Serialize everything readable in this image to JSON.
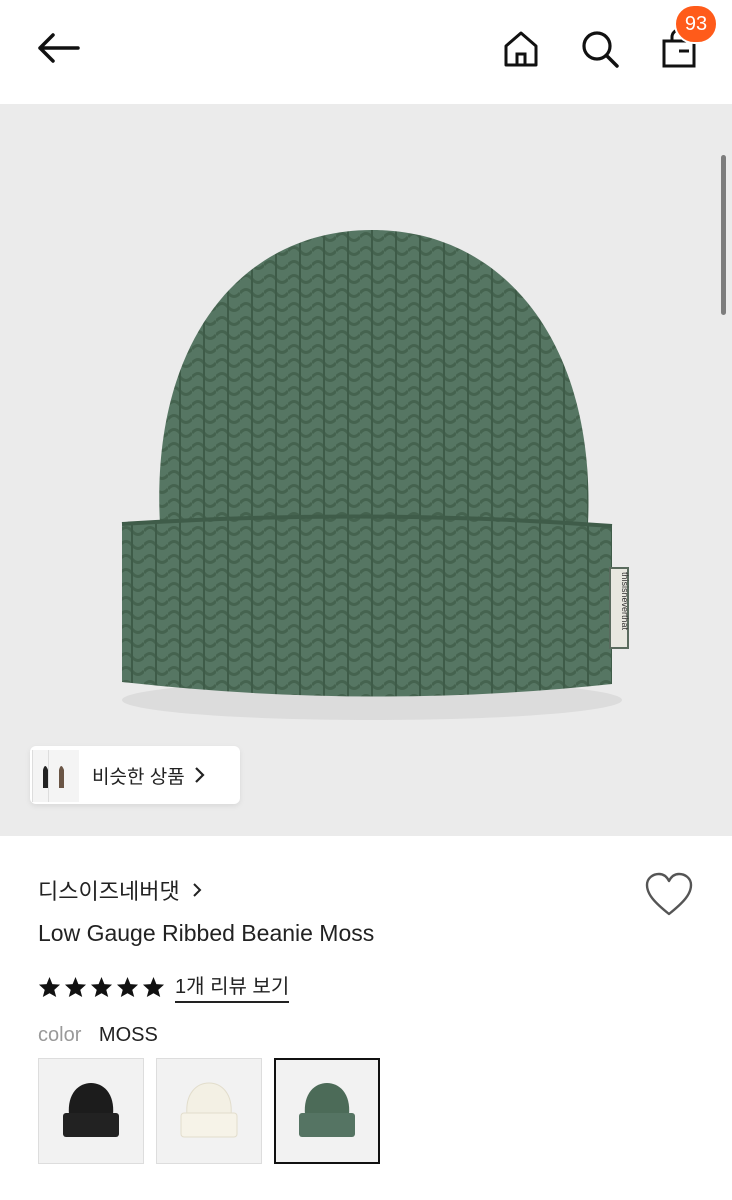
{
  "header": {
    "cart_count": "93",
    "icons": [
      "arrow-left-icon",
      "home-icon",
      "search-icon",
      "shopping-bag-icon"
    ]
  },
  "hero": {
    "tag_text": "thisisneverthat",
    "similar_label": "비슷한 상품"
  },
  "product": {
    "brand": "디스이즈네버댓",
    "title": "Low Gauge Ribbed Beanie Moss",
    "rating_stars": 5,
    "reviews_label": "1개 리뷰 보기"
  },
  "options": {
    "color_key": "color",
    "color_value": "MOSS",
    "swatches": [
      {
        "name": "black",
        "color": "#1c1c1c"
      },
      {
        "name": "cream",
        "color": "#f3f0e4"
      },
      {
        "name": "moss",
        "color": "#4c6b58",
        "selected": true
      }
    ]
  },
  "colors": {
    "badge": "#ff5b1a",
    "hero_bg": "#ebebeb",
    "beanie": "#547561"
  }
}
